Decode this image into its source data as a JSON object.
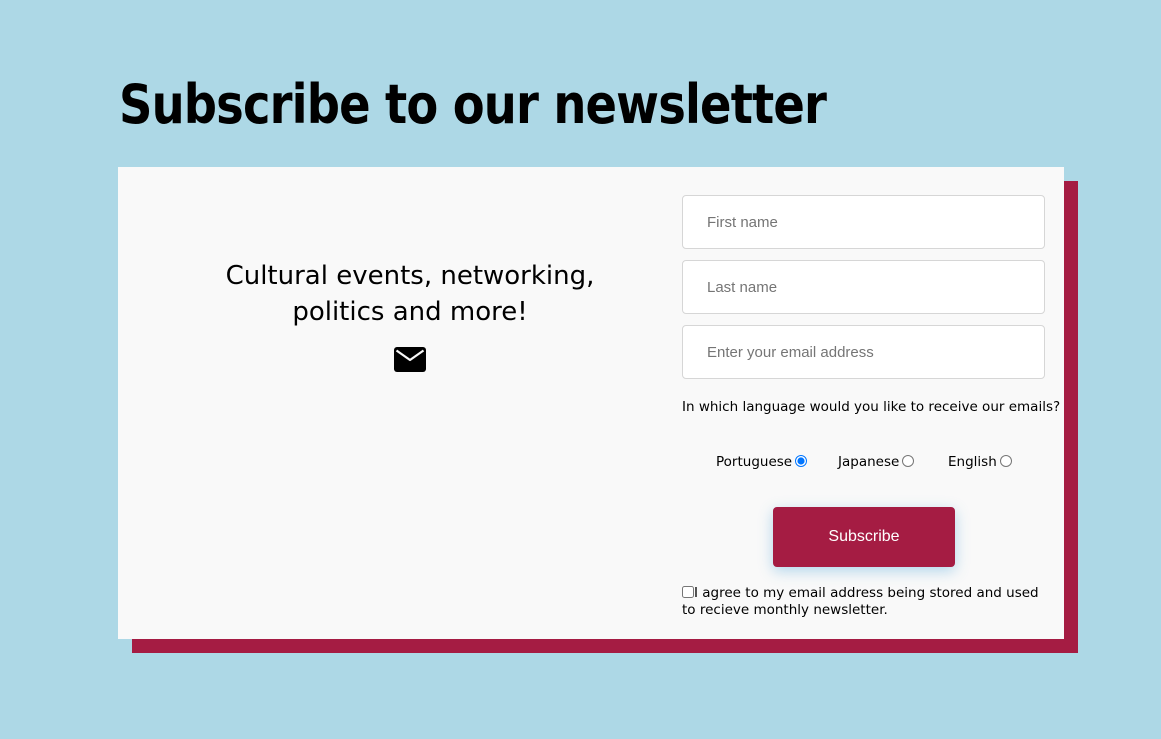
{
  "header": {
    "title": "Subscribe to our newsletter"
  },
  "intro": {
    "tagline": "Cultural events, networking, politics and more!",
    "icon": "envelope-icon"
  },
  "form": {
    "first_name": {
      "placeholder": "First name",
      "value": ""
    },
    "last_name": {
      "placeholder": "Last name",
      "value": ""
    },
    "email": {
      "placeholder": "Enter your email address",
      "value": ""
    },
    "language_question": "In which language would you like to receive our emails?",
    "languages": [
      {
        "label": "Portuguese",
        "selected": true
      },
      {
        "label": "Japanese",
        "selected": false
      },
      {
        "label": "English",
        "selected": false
      }
    ],
    "subscribe_label": "Subscribe",
    "consent_label": "I agree to my email address being stored and used to recieve monthly newsletter.",
    "consent_checked": false
  },
  "colors": {
    "background": "#add8e6",
    "accent": "#a51c43",
    "card": "#f9f9f9"
  }
}
